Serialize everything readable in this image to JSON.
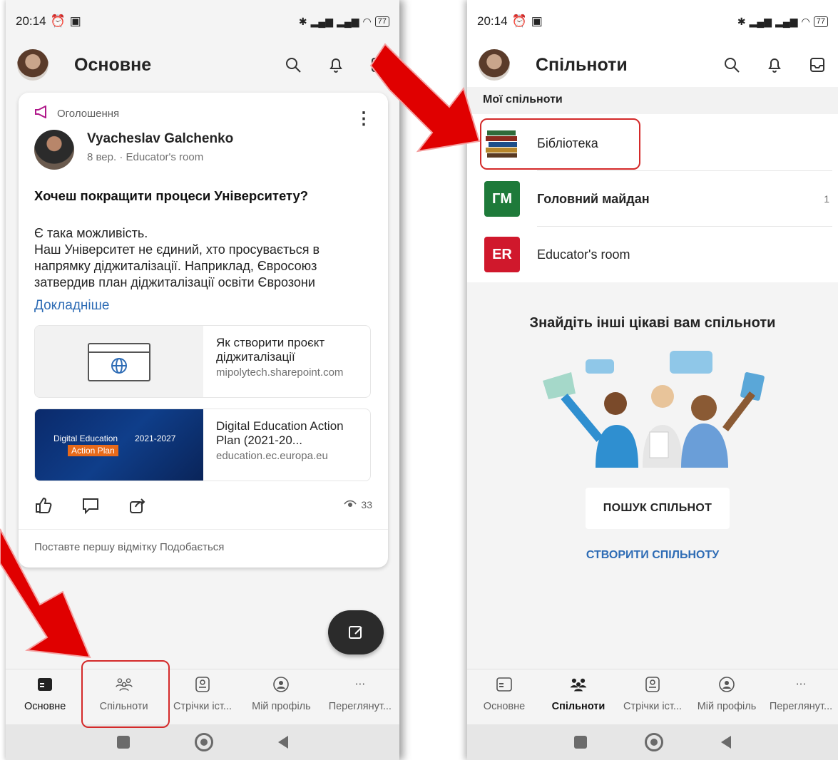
{
  "status": {
    "time": "20:14",
    "battery": "77"
  },
  "left": {
    "title": "Основне",
    "post": {
      "type_label": "Оголошення",
      "author": "Vyacheslav Galchenko",
      "meta": "8 вер. · Educator's room",
      "headline": "Хочеш покращити процеси Університету?",
      "body_1": "Є така можливість.",
      "body_2": "Наш Університет не єдиний, хто просувається в напрямку діджиталізації. Наприклад, Євросоюз затвердив план діджиталізації освіти Єврозони",
      "more": "Докладніше",
      "link1": {
        "title": "Як створити проєкт діджиталізації",
        "url": "mipolytech.sharepoint.com"
      },
      "link2": {
        "title": "Digital Education Action Plan (2021-20...",
        "url": "education.ec.europa.eu",
        "thumb_text": "Digital Education",
        "thumb_years": "2021-2027",
        "thumb_plan": "Action Plan"
      },
      "views": "33",
      "like_prompt": "Поставте першу відмітку Подобається"
    }
  },
  "right": {
    "title": "Спільноти",
    "section": "Мої спільноти",
    "communities": [
      {
        "name": "Бібліотека",
        "icon": "books"
      },
      {
        "name": "Головний майдан",
        "abbr": "ГМ",
        "count": "1",
        "color": "#1e7a3a"
      },
      {
        "name": "Educator's room",
        "abbr": "ER",
        "color": "#d0182c"
      }
    ],
    "discover_title": "Знайдіть інші цікаві вам спільноти",
    "search_button": "ПОШУК СПІЛЬНОТ",
    "create_link": "СТВОРИТИ СПІЛЬНОТУ"
  },
  "nav": [
    "Основне",
    "Спільноти",
    "Стрічки іст...",
    "Мій профіль",
    "Переглянут..."
  ],
  "nav_right_last": "Переглянут...",
  "colors": {
    "accent_link": "#2e6cb5",
    "highlight": "#d42a2a",
    "arrow": "#e00000"
  }
}
